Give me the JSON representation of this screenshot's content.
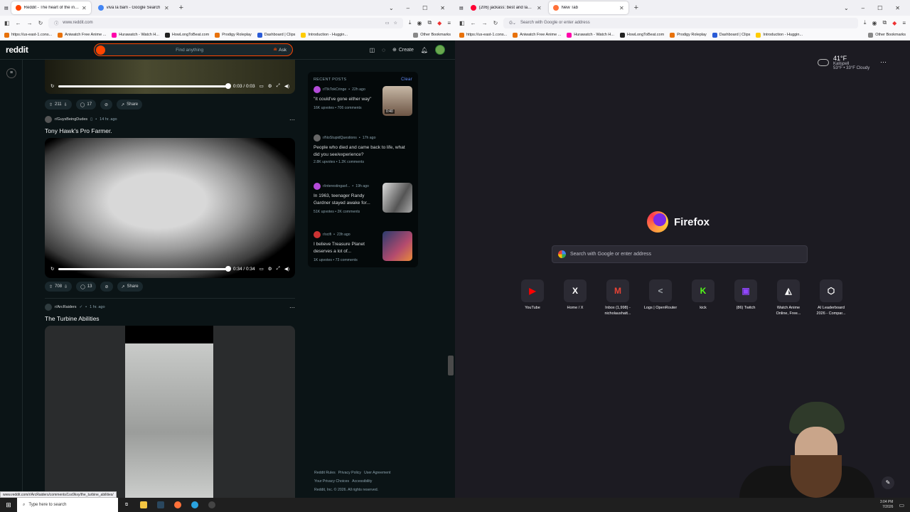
{
  "left_browser": {
    "tabs": [
      {
        "label": "Reddit - The heart of the internet",
        "color": "#ff4500",
        "active": true
      },
      {
        "label": "viva la bam - Google Search",
        "color": "#4285f4",
        "active": false
      }
    ],
    "url": "www.reddit.com",
    "bookmarks": [
      "https://us-east-1.cons...",
      "Aniwatch Free Anime ...",
      "Hurawatch - Watch H...",
      "HowLongToBeat.com",
      "Prodigy Roleplay",
      "Dashboard | Clips",
      "Introduction - Huggin..."
    ],
    "other_bookmarks": "Other Bookmarks"
  },
  "right_browser": {
    "tabs": [
      {
        "label": "(206) jackass: best and last | Off...",
        "color": "#ff0033",
        "active": false
      },
      {
        "label": "New Tab",
        "color": "#ff7139",
        "active": true
      }
    ],
    "url_placeholder": "Search with Google or enter address",
    "bookmarks": [
      "https://us-east-1.cons...",
      "Aniwatch Free Anime ...",
      "Hurawatch - Watch H...",
      "HowLongToBeat.com",
      "Prodigy Roleplay",
      "Dashboard | Clips",
      "Introduction - Huggin..."
    ],
    "other_bookmarks": "Other Bookmarks"
  },
  "reddit": {
    "logo": "reddit",
    "search_placeholder": "Find anything",
    "ask": "Ask",
    "create": "Create",
    "notif_count": "1",
    "post1": {
      "time": "0:03 / 0:03",
      "votes": "211",
      "comments": "17",
      "share": "Share"
    },
    "post2": {
      "sub": "r/GuysBeingDudes",
      "age": "14 hr. ago",
      "title": "Tony Hawk's Pro Farmer.",
      "time": "0:34 / 0:34",
      "votes": "708",
      "comments": "13",
      "share": "Share"
    },
    "post3": {
      "sub": "r/ArcRaiders",
      "age": "1 hr. ago",
      "title": "The Turbine Abilities"
    },
    "recent": {
      "heading": "RECENT POSTS",
      "clear": "Clear",
      "items": [
        {
          "sub": "r/TikTokCringe",
          "age": "22h ago",
          "title": "\"It could've gone either way\"",
          "upvotes": "16K upvotes",
          "comments": "706 comments",
          "thumb_color": "#8a6d5a",
          "badge": "0:40"
        },
        {
          "sub": "r/NoStupidQuestions",
          "age": "17h ago",
          "title": "People who died and came back to life, what did you see/experience?",
          "upvotes": "2.8K upvotes",
          "comments": "1.2K comments"
        },
        {
          "sub": "r/interestingasf...",
          "age": "19h ago",
          "title": "In 1963, teenager Randy Gardner stayed awake for...",
          "upvotes": "51K upvotes",
          "comments": "2K comments",
          "thumb_color": "#777777"
        },
        {
          "sub": "r/scifi",
          "age": "23h ago",
          "title": "I believe Treasure Planet deserves a lot of...",
          "upvotes": "1K upvotes",
          "comments": "73 comments",
          "thumb_color": "#5b3a6e"
        }
      ]
    },
    "footer": {
      "rules": "Reddit Rules",
      "privacy": "Privacy Policy",
      "agreement": "User Agreement",
      "choices": "Your Privacy Choices",
      "access": "Accessibility",
      "copyright": "Reddit, Inc. © 2026. All rights reserved."
    },
    "status_url": "www.reddit.com/r/ArcRaiders/comments/1sx9kxy/the_turbine_abilities/"
  },
  "newtab": {
    "weather": {
      "temp": "41°F",
      "location": "Kalispell",
      "detail": "53°F • 33°F  Cloudy"
    },
    "brand": "Firefox",
    "search_placeholder": "Search with Google or enter address",
    "tiles": [
      {
        "label": "YouTube",
        "glyph": "▶",
        "color": "#ff0000"
      },
      {
        "label": "Home / X",
        "glyph": "X",
        "color": "#ffffff"
      },
      {
        "label": "Inbox (1,998) - nicholaushatt...",
        "glyph": "M",
        "color": "#ea4335"
      },
      {
        "label": "Logs | OpenRouter",
        "glyph": "<",
        "color": "#9aa0a6"
      },
      {
        "label": "kick",
        "glyph": "K",
        "color": "#53fc18"
      },
      {
        "label": "(86) Twitch",
        "glyph": "▣",
        "color": "#9146ff"
      },
      {
        "label": "Watch Anime Online, Free...",
        "glyph": "◭",
        "color": "#ffffff"
      },
      {
        "label": "AI Leaderboard 2026 - Compar...",
        "glyph": "⬡",
        "color": "#ffffff"
      }
    ]
  },
  "taskbar": {
    "search": "Type here to search",
    "time": "3:04 PM",
    "date": "7/2026"
  }
}
